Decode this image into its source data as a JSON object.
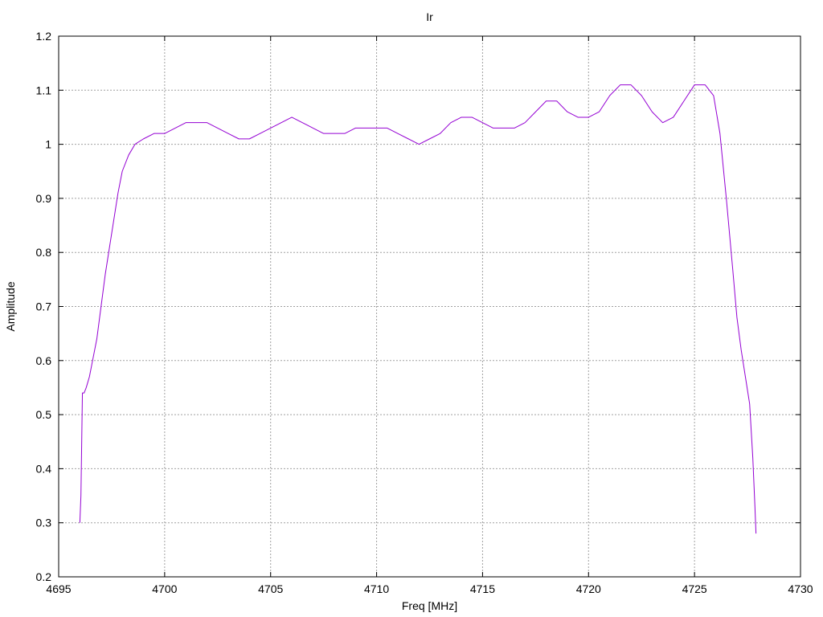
{
  "chart_data": {
    "type": "line",
    "title": "Ir",
    "xlabel": "Freq [MHz]",
    "ylabel": "Amplitude",
    "xlim": [
      4695,
      4730
    ],
    "ylim": [
      0.2,
      1.2
    ],
    "xticks": [
      4695,
      4700,
      4705,
      4710,
      4715,
      4720,
      4725,
      4730
    ],
    "yticks": [
      0.2,
      0.3,
      0.4,
      0.5,
      0.6,
      0.7,
      0.8,
      0.9,
      1,
      1.1,
      1.2
    ],
    "xtick_labels": [
      "4695",
      "4700",
      "4705",
      "4710",
      "4715",
      "4720",
      "4725",
      "4730"
    ],
    "ytick_labels": [
      "0.2",
      "0.3",
      "0.4",
      "0.5",
      "0.6",
      "0.7",
      "0.8",
      "0.9",
      "1",
      "1.1",
      "1.2"
    ],
    "grid": true,
    "series": [
      {
        "color": "#9400d3",
        "x": [
          4696.0,
          4696.05,
          4696.12,
          4696.2,
          4696.3,
          4696.45,
          4696.6,
          4696.8,
          4697.0,
          4697.2,
          4697.4,
          4697.6,
          4697.8,
          4698.0,
          4698.3,
          4698.6,
          4699.0,
          4699.5,
          4700.0,
          4700.5,
          4701.0,
          4701.5,
          4702.0,
          4702.5,
          4703.0,
          4703.5,
          4704.0,
          4704.5,
          4705.0,
          4705.5,
          4706.0,
          4706.5,
          4707.0,
          4707.5,
          4708.0,
          4708.5,
          4709.0,
          4709.5,
          4710.0,
          4710.5,
          4711.0,
          4711.5,
          4712.0,
          4712.5,
          4713.0,
          4713.5,
          4714.0,
          4714.5,
          4715.0,
          4715.5,
          4716.0,
          4716.5,
          4717.0,
          4717.5,
          4718.0,
          4718.5,
          4719.0,
          4719.5,
          4720.0,
          4720.5,
          4721.0,
          4721.5,
          4722.0,
          4722.5,
          4723.0,
          4723.5,
          4724.0,
          4724.5,
          4725.0,
          4725.5,
          4725.9,
          4726.2,
          4726.5,
          4726.8,
          4727.0,
          4727.2,
          4727.4,
          4727.6,
          4727.75,
          4727.85,
          4727.9
        ],
        "y": [
          0.3,
          0.35,
          0.54,
          0.54,
          0.55,
          0.57,
          0.6,
          0.64,
          0.7,
          0.76,
          0.81,
          0.86,
          0.91,
          0.95,
          0.98,
          1.0,
          1.01,
          1.02,
          1.02,
          1.03,
          1.04,
          1.04,
          1.04,
          1.03,
          1.02,
          1.01,
          1.01,
          1.02,
          1.03,
          1.04,
          1.05,
          1.04,
          1.03,
          1.02,
          1.02,
          1.02,
          1.03,
          1.03,
          1.03,
          1.03,
          1.02,
          1.01,
          1.0,
          1.01,
          1.02,
          1.04,
          1.05,
          1.05,
          1.04,
          1.03,
          1.03,
          1.03,
          1.04,
          1.06,
          1.08,
          1.08,
          1.06,
          1.05,
          1.05,
          1.06,
          1.09,
          1.11,
          1.11,
          1.09,
          1.06,
          1.04,
          1.05,
          1.08,
          1.11,
          1.11,
          1.09,
          1.02,
          0.9,
          0.77,
          0.68,
          0.62,
          0.57,
          0.52,
          0.42,
          0.33,
          0.28
        ]
      }
    ]
  }
}
